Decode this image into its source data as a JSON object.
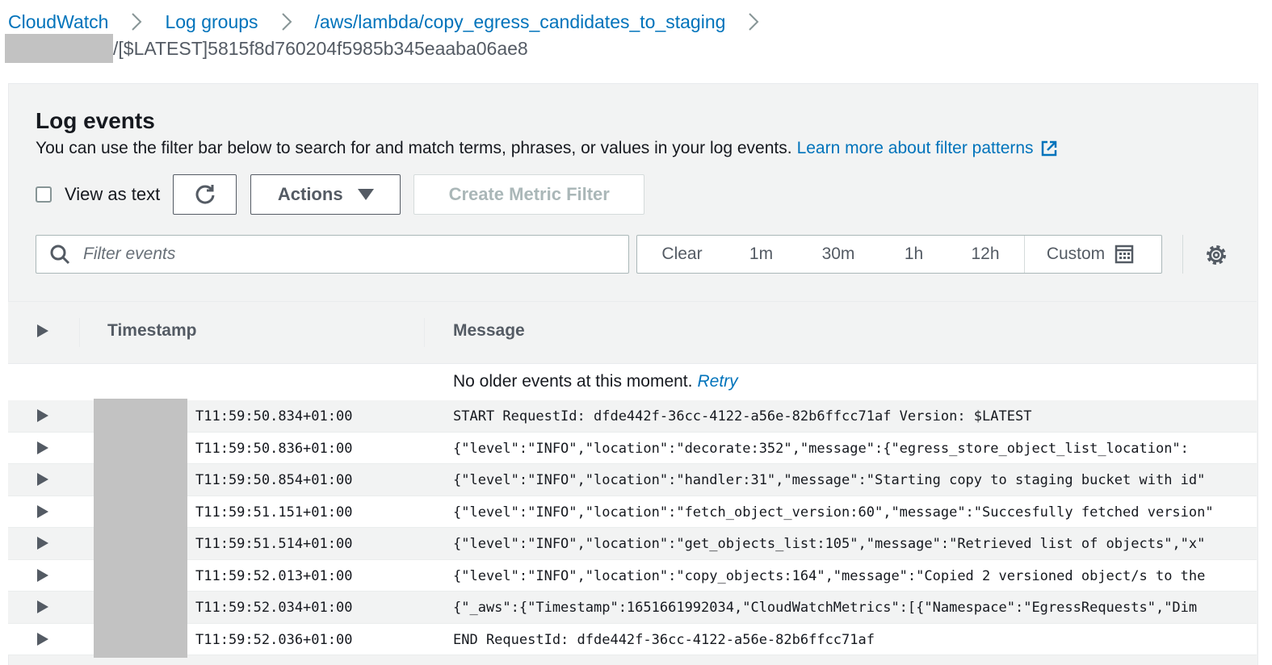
{
  "breadcrumb": {
    "items": [
      "CloudWatch",
      "Log groups",
      "/aws/lambda/copy_egress_candidates_to_staging"
    ],
    "stream": "/[$LATEST]5815f8d760204f5985b345eaaba06ae8"
  },
  "panel": {
    "title": "Log events",
    "description": "You can use the filter bar below to search for and match terms, phrases, or values in your log events.",
    "learn_more": "Learn more about filter patterns",
    "view_as_text": "View as text",
    "actions_label": "Actions",
    "create_metric_filter": "Create Metric Filter",
    "filter_placeholder": "Filter events",
    "ranges": [
      "Clear",
      "1m",
      "30m",
      "1h",
      "12h"
    ],
    "custom_label": "Custom"
  },
  "table": {
    "col_timestamp": "Timestamp",
    "col_message": "Message",
    "no_older": "No older events at this moment.",
    "retry": "Retry",
    "rows": [
      {
        "ts": "T11:59:50.834+01:00",
        "msg": "START RequestId: dfde442f-36cc-4122-a56e-82b6ffcc71af Version: $LATEST"
      },
      {
        "ts": "T11:59:50.836+01:00",
        "msg": "{\"level\":\"INFO\",\"location\":\"decorate:352\",\"message\":{\"egress_store_object_list_location\":"
      },
      {
        "ts": "T11:59:50.854+01:00",
        "msg": "{\"level\":\"INFO\",\"location\":\"handler:31\",\"message\":\"Starting copy to staging bucket with id\""
      },
      {
        "ts": "T11:59:51.151+01:00",
        "msg": "{\"level\":\"INFO\",\"location\":\"fetch_object_version:60\",\"message\":\"Succesfully fetched version\""
      },
      {
        "ts": "T11:59:51.514+01:00",
        "msg": "{\"level\":\"INFO\",\"location\":\"get_objects_list:105\",\"message\":\"Retrieved list of objects\",\"x\""
      },
      {
        "ts": "T11:59:52.013+01:00",
        "msg": "{\"level\":\"INFO\",\"location\":\"copy_objects:164\",\"message\":\"Copied 2 versioned object/s to the"
      },
      {
        "ts": "T11:59:52.034+01:00",
        "msg": "{\"_aws\":{\"Timestamp\":1651661992034,\"CloudWatchMetrics\":[{\"Namespace\":\"EgressRequests\",\"Dim"
      },
      {
        "ts": "T11:59:52.036+01:00",
        "msg": "END RequestId: dfde442f-36cc-4122-a56e-82b6ffcc71af"
      }
    ]
  }
}
